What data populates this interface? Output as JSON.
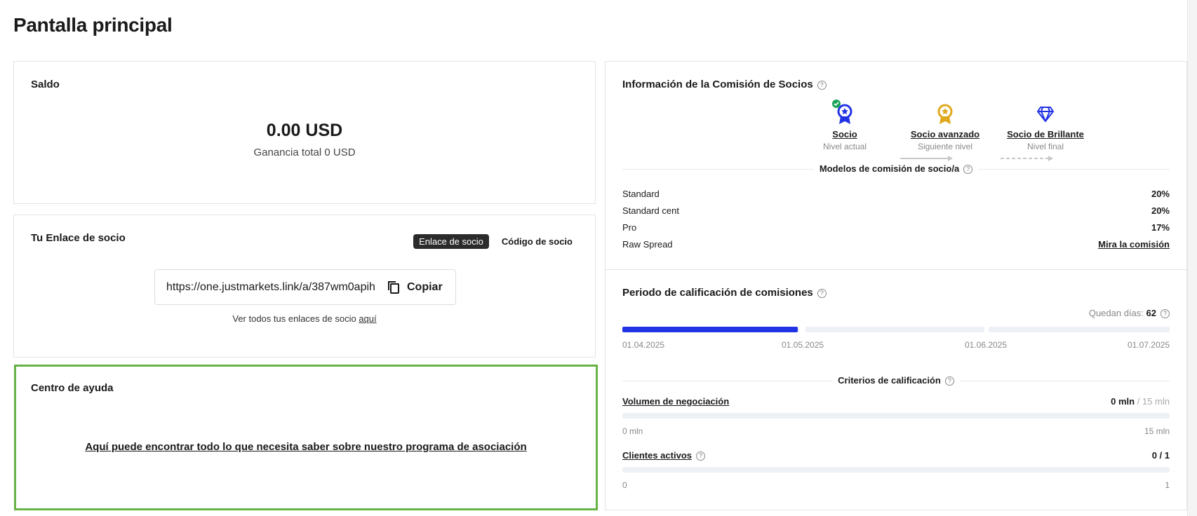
{
  "page": {
    "title": "Pantalla principal"
  },
  "balance": {
    "title": "Saldo",
    "amount": "0.00 USD",
    "total_label": "Ganancia total 0 USD"
  },
  "partner_link": {
    "title": "Tu Enlace de socio",
    "tab_link": "Enlace de socio",
    "tab_code": "Código de socio",
    "url": "https://one.justmarkets.link/a/387wm0apih",
    "copy_label": "Copiar",
    "note_prefix": "Ver todos tus enlaces de socio ",
    "note_link": "aquí"
  },
  "help": {
    "title": "Centro de ayuda",
    "link": "Aquí puede encontrar todo lo que necesita saber sobre nuestro programa de asociación"
  },
  "commission": {
    "title": "Información de la Comisión de Socios",
    "levels": [
      {
        "name": "Socio",
        "sub": "Nivel actual",
        "icon": "ribbon-medal-blue-icon",
        "color": "#2233e6"
      },
      {
        "name": "Socio avanzado",
        "sub": "Siguiente nivel",
        "icon": "ribbon-medal-gold-icon",
        "color": "#e0a81c"
      },
      {
        "name": "Socio de Brillante",
        "sub": "Nivel final",
        "icon": "diamond-icon",
        "color": "#2233e6"
      }
    ],
    "models_label": "Modelos de comisión de socio/a",
    "models": [
      {
        "name": "Standard",
        "value": "20%"
      },
      {
        "name": "Standard cent",
        "value": "20%"
      },
      {
        "name": "Pro",
        "value": "17%"
      },
      {
        "name": "Raw Spread",
        "value": "Mira la comisión"
      }
    ]
  },
  "period": {
    "title": "Periodo de calificación de comisiones",
    "days_label": "Quedan días:",
    "days_value": "62",
    "progress_fraction": 0.32,
    "dates": [
      "01.04.2025",
      "01.05.2025",
      "01.06.2025",
      "01.07.2025"
    ],
    "criteria_label": "Criterios de calificación",
    "criteria": [
      {
        "name": "Volumen de negociación",
        "current": "0 mln",
        "target": "/ 15 mln",
        "min": "0 mln",
        "max": "15 mln",
        "progress": 0
      },
      {
        "name": "Clientes activos",
        "current": "0 / 1",
        "target": "",
        "min": "0",
        "max": "1",
        "progress": 0
      }
    ]
  },
  "colors": {
    "accent": "#2233e6",
    "help_border": "#67b346",
    "check": "#1aa35a"
  }
}
